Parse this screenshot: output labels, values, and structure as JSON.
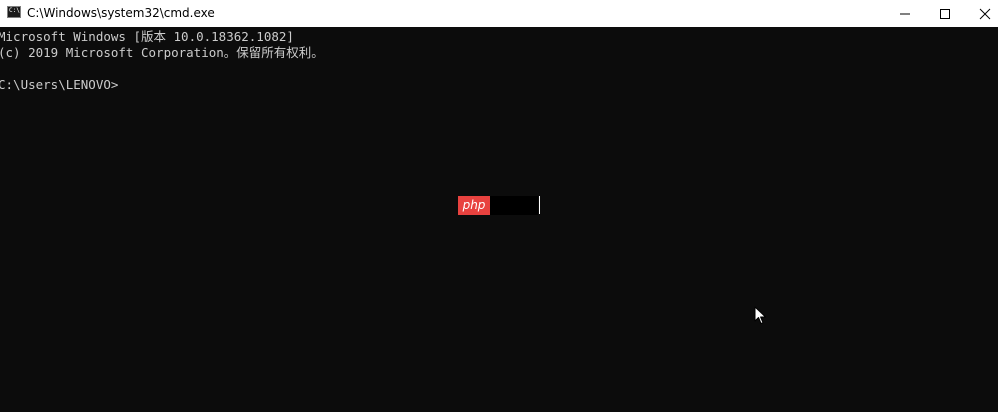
{
  "window": {
    "title": "C:\\Windows\\system32\\cmd.exe",
    "app_icon_glyph": "C:\\",
    "background": "#0c0c0c",
    "titlebar_background": "#ffffff"
  },
  "console": {
    "lines": [
      "Microsoft Windows [版本 10.0.18362.1082]",
      "(c) 2019 Microsoft Corporation。保留所有权利。",
      "C:\\Users\\LENOVO>"
    ],
    "text_color": "#cccccc"
  },
  "overlay": {
    "logo_text": "php",
    "logo_color": "#e8423f"
  },
  "icons": {
    "minimize": "minimize-icon",
    "maximize": "maximize-icon",
    "close": "close-icon",
    "pointer": "mouse-pointer-icon"
  }
}
